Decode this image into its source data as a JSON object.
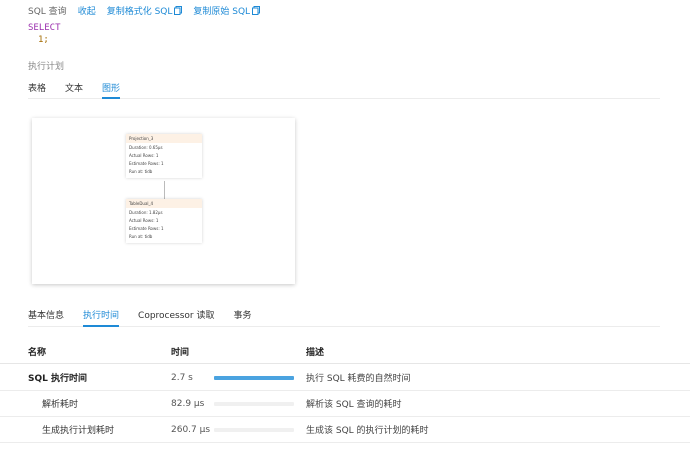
{
  "sql_bar": {
    "label": "SQL 查询",
    "collapse": "收起",
    "copy_formatted": "复制格式化 SQL",
    "copy_raw": "复制原始 SQL",
    "copy_icon": "copy-icon",
    "accent": "#1e8ad6"
  },
  "code": {
    "keyword": "SELECT",
    "value": "1;"
  },
  "plan": {
    "title": "执行计划",
    "tabs": [
      "表格",
      "文本",
      "图形"
    ],
    "active_tab": "图形",
    "nodes": [
      {
        "name": "Projection_3",
        "duration": "Duration: 0.65µs",
        "actual_rows": "Actual Rows: 1",
        "estimate_rows": "Estimate Rows: 1",
        "run_at": "Run at: tidb"
      },
      {
        "name": "TableDual_4",
        "duration": "Duration: 1.82µs",
        "actual_rows": "Actual Rows: 1",
        "estimate_rows": "Estimate Rows: 1",
        "run_at": "Run at: tidb"
      }
    ]
  },
  "detail_tabs": {
    "tabs": [
      "基本信息",
      "执行时间",
      "Coprocessor 读取",
      "事务"
    ],
    "active_tab": "执行时间"
  },
  "table": {
    "headers": [
      "名称",
      "时间",
      "描述"
    ],
    "rows": [
      {
        "name": "SQL 执行时间",
        "time": "2.7 s",
        "progress": 1.0,
        "desc": "执行 SQL 耗费的自然时间"
      },
      {
        "name": "解析耗时",
        "time": "82.9 µs",
        "progress": 0.0,
        "desc": "解析该 SQL 查询的耗时"
      },
      {
        "name": "生成执行计划耗时",
        "time": "260.7 µs",
        "progress": 0.0,
        "desc": "生成该 SQL 的执行计划的耗时"
      }
    ],
    "bar_color": "#4aa3e0"
  }
}
